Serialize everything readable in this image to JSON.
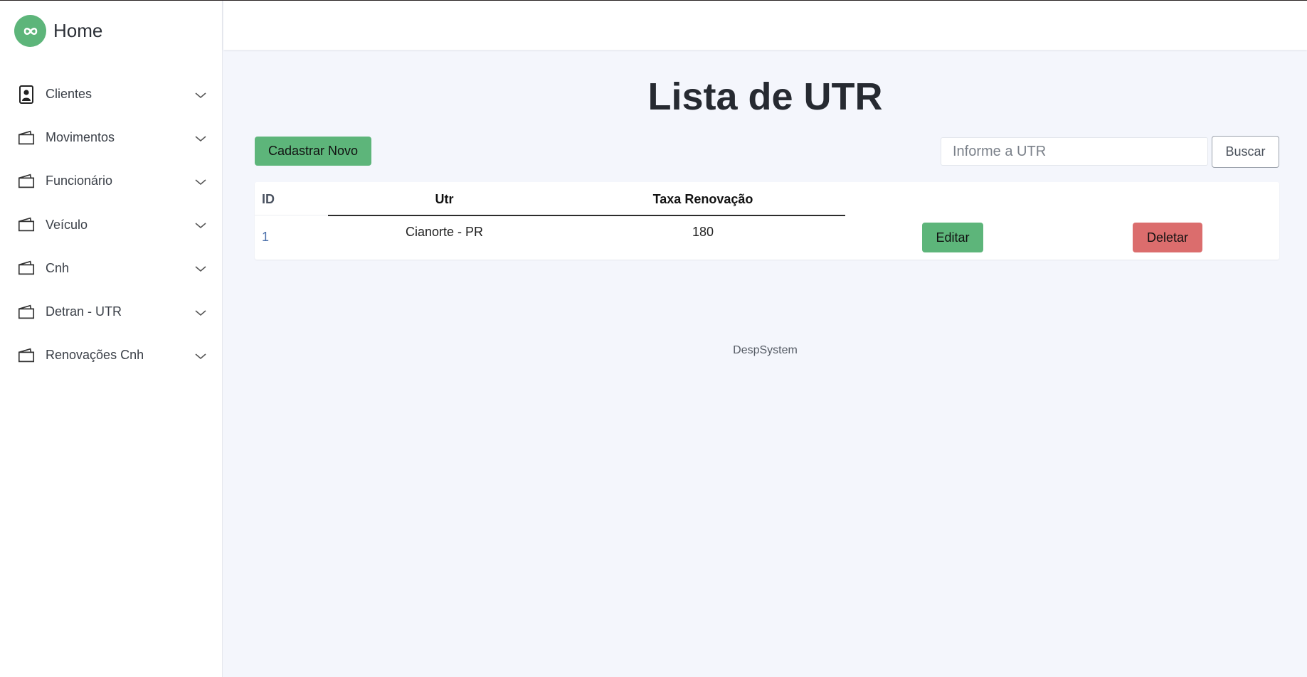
{
  "sidebar": {
    "brand": {
      "title": "Home",
      "logo_icon": "infinity-icon",
      "logo_color": "#5db57a"
    },
    "items": [
      {
        "label": "Clientes",
        "icon": "contact-card-icon"
      },
      {
        "label": "Movimentos",
        "icon": "wallet-icon"
      },
      {
        "label": "Funcionário",
        "icon": "wallet-icon"
      },
      {
        "label": "Veículo",
        "icon": "wallet-icon"
      },
      {
        "label": "Cnh",
        "icon": "wallet-icon"
      },
      {
        "label": "Detran - UTR",
        "icon": "wallet-icon"
      },
      {
        "label": "Renovações Cnh",
        "icon": "wallet-icon"
      }
    ]
  },
  "main": {
    "title": "Lista de UTR",
    "new_button": "Cadastrar Novo",
    "search": {
      "placeholder": "Informe a UTR",
      "value": "",
      "button": "Buscar"
    },
    "table": {
      "headers": {
        "id": "ID",
        "utr": "Utr",
        "taxa": "Taxa Renovação"
      },
      "rows": [
        {
          "id": "1",
          "utr": "Cianorte - PR",
          "taxa": "180",
          "edit": "Editar",
          "delete": "Deletar"
        }
      ]
    },
    "footer": "DespSystem"
  },
  "colors": {
    "accent_green": "#5db57a",
    "danger_red": "#db6d6d",
    "background": "#f4f6fc"
  }
}
